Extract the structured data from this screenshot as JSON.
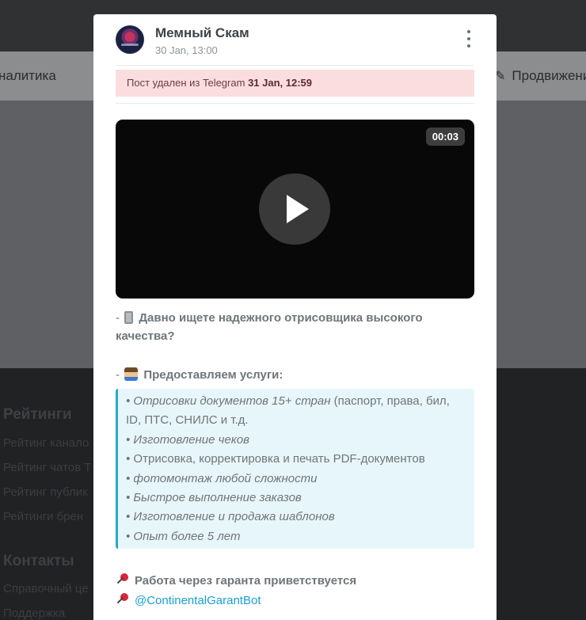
{
  "background": {
    "nav_left": "налитика",
    "nav_right": "Продвижени",
    "footer": {
      "ratings_title": "Рейтинги",
      "ratings_links": [
        "Рейтинг канало",
        "Рейтинг чатов Т",
        "Рейтинг публик",
        "Рейтинги брен"
      ],
      "contacts_title": "Контакты",
      "contacts_links": [
        "Справочный це",
        "Поддержка"
      ]
    }
  },
  "post": {
    "channel_name": "Мемный Скам",
    "date": "30 Jan, 13:00",
    "deleted_notice": {
      "prefix": "Пост удален из Telegram",
      "date": "31 Jan, 12:59"
    },
    "video": {
      "duration": "00:03"
    },
    "text": {
      "line1_prefix": "-",
      "line1_bold": "Давно ищете надежного отрисовщика высокого качества?",
      "line2_prefix": "-",
      "line2_bold": "Предоставляем услуги:",
      "services": [
        {
          "italic": "• Отрисовки документов 15+ стран",
          "normal": " (паспорт, права, бил, ID, ПТС, СНИЛС и т.д."
        },
        {
          "italic": "• Изготовление чеков",
          "normal": ""
        },
        {
          "italic": "•",
          "normal": " Отрисовка, корректировка и печать PDF-документов"
        },
        {
          "italic": "• фотомонтаж любой сложности",
          "normal": ""
        },
        {
          "italic": "• Быстрое выполнение заказов",
          "normal": ""
        },
        {
          "italic": "• Изготовление и продажа шаблонов",
          "normal": ""
        },
        {
          "italic": "• Опыт более 5 лет",
          "normal": ""
        }
      ],
      "guarantee": "Работа через гаранта приветствуется",
      "bot_link": "@ContinentalGarantBot"
    }
  },
  "icons": {
    "menu": "kebab-menu-icon",
    "play": "play-icon",
    "phone_emoji": "phone-emoji-icon",
    "person_emoji": "person-emoji-icon",
    "pin_emoji": "pushpin-icon"
  }
}
